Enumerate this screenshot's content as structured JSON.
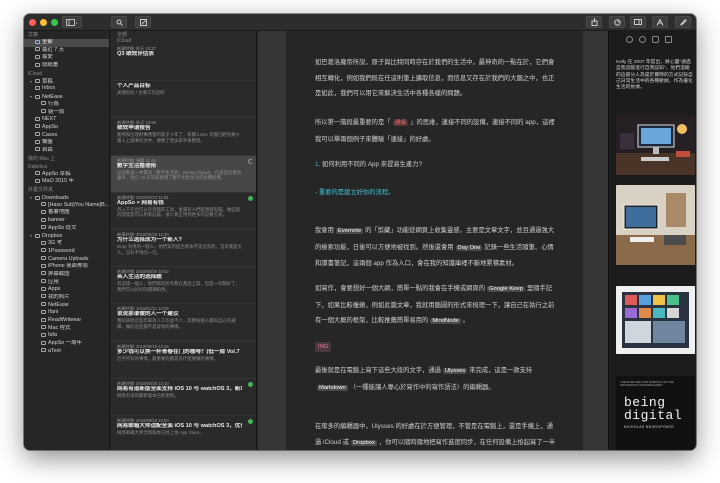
{
  "library": {
    "sections": [
      {
        "title": "文庫",
        "items": [
          {
            "label": "全部",
            "icon": "tray-icon",
            "color": "#8fb3e6",
            "selected": true
          },
          {
            "label": "最近 7 天",
            "icon": "clock-icon",
            "color": "#a8a8a8"
          },
          {
            "label": "最愛",
            "icon": "heart-icon",
            "color": "#a8a8a8"
          },
          {
            "label": "廢紙簍",
            "icon": "trash-icon",
            "color": "#a8a8a8"
          }
        ]
      },
      {
        "title": "iCloud",
        "items": [
          {
            "label": "草稿",
            "icon": "folder-icon",
            "color": "#a8a8a8",
            "tri": true
          },
          {
            "label": "Inbox",
            "icon": "folder-icon",
            "color": "#a8a8a8"
          },
          {
            "label": "NetEase",
            "icon": "folder-icon",
            "color": "#a8a8a8",
            "tri": true
          },
          {
            "label": "行為",
            "icon": "folder-icon",
            "color": "#a8a8a8",
            "indent": 1
          },
          {
            "label": "链一周",
            "icon": "folder-icon",
            "color": "#a8a8a8",
            "indent": 1
          },
          {
            "label": "NEXT",
            "icon": "folder-icon",
            "color": "#a8a8a8"
          },
          {
            "label": "AppSo",
            "icon": "folder-icon",
            "color": "#a8a8a8"
          },
          {
            "label": "Cases",
            "icon": "folder-icon",
            "color": "#a8a8a8"
          },
          {
            "label": "懶盤",
            "icon": "folder-icon",
            "color": "#a8a8a8"
          },
          {
            "label": "自由",
            "icon": "folder-icon",
            "color": "#a8a8a8"
          }
        ]
      },
      {
        "title": "我的 Mac 上",
        "items": []
      },
      {
        "title": "Dabelius",
        "items": [
          {
            "label": "AppSo 草稿",
            "icon": "folder-icon",
            "color": "#a8a8a8"
          },
          {
            "label": "MaO 2015 年",
            "icon": "folder-icon",
            "color": "#a8a8a8"
          }
        ]
      },
      {
        "title": "外置文件夹",
        "items": [
          {
            "label": "Downloads",
            "icon": "folder-icon",
            "color": "#a8a8a8",
            "tri": true
          },
          {
            "label": "[Haso Sub]You Name]B...",
            "icon": "folder-icon",
            "color": "#a8a8a8",
            "indent": 1
          },
          {
            "label": "番薯地圖",
            "icon": "folder-icon",
            "color": "#a8a8a8",
            "indent": 1
          },
          {
            "label": "banner",
            "icon": "folder-icon",
            "color": "#a8a8a8",
            "indent": 1
          },
          {
            "label": "AppSo 從文",
            "icon": "folder-icon",
            "color": "#a8a8a8",
            "indent": 1
          },
          {
            "label": "Dropbox",
            "icon": "folder-icon",
            "color": "#a8a8a8",
            "tri": true
          },
          {
            "label": "3G 考",
            "icon": "folder-icon",
            "color": "#a8a8a8",
            "indent": 1
          },
          {
            "label": "1Password",
            "icon": "folder-icon",
            "color": "#a8a8a8",
            "indent": 1
          },
          {
            "label": "Camera Uploads",
            "icon": "folder-icon",
            "color": "#a8a8a8",
            "indent": 1
          },
          {
            "label": "iPhone 桌面佈局",
            "icon": "folder-icon",
            "color": "#a8a8a8",
            "indent": 1
          },
          {
            "label": "屏幕截图",
            "icon": "folder-icon",
            "color": "#a8a8a8",
            "indent": 1
          },
          {
            "label": "应用",
            "icon": "folder-icon",
            "color": "#a8a8a8",
            "indent": 1
          },
          {
            "label": "Apps",
            "icon": "folder-icon",
            "color": "#a8a8a8",
            "indent": 1
          },
          {
            "label": "我的照片",
            "icon": "folder-icon",
            "color": "#a8a8a8",
            "indent": 1
          },
          {
            "label": "NetEase",
            "icon": "folder-icon",
            "color": "#a8a8a8",
            "indent": 1
          },
          {
            "label": "Ifani",
            "icon": "folder-icon",
            "color": "#a8a8a8",
            "indent": 1
          },
          {
            "label": "ReadWriteear",
            "icon": "folder-icon",
            "color": "#a8a8a8",
            "indent": 1
          },
          {
            "label": "Mac 程式",
            "icon": "folder-icon",
            "color": "#a8a8a8",
            "indent": 1
          },
          {
            "label": "fafa",
            "icon": "folder-icon",
            "color": "#a8a8a8",
            "indent": 1
          },
          {
            "label": "AppSo 一周年",
            "icon": "folder-icon",
            "color": "#a8a8a8",
            "indent": 1
          },
          {
            "label": "aText",
            "icon": "folder-icon",
            "color": "#a8a8a8",
            "indent": 1
          }
        ]
      }
    ]
  },
  "sheet_list": {
    "header": "全部",
    "subheader": "iCloud",
    "sheets": [
      {
        "date": "創建時間: 昨天 10:37",
        "title": "Q3 绩效评估表",
        "body": "",
        "mark": "none"
      },
      {
        "date": "",
        "title": "个人产品目标",
        "body": "关键指标 / 主要工作说明",
        "mark": "none"
      },
      {
        "date": "創建時間: 昨天 10:56",
        "title": "绩效申请报告",
        "body": "鹿鳴和位理財事務管的案子十年了，嵌關 lustre 可能已經有幾十萬十上城事的文件，便捷了更多新手來整理。",
        "mark": "none"
      },
      {
        "date": "創建時間: 週曆 11:44",
        "title": "數字生活整理術",
        "body": "記得看過一本書叫『數字生活者』(Being Digital)，作者是尼葛洛龐帝。他在 20 年前就預測了數字化對生活的各種影響。",
        "mark": "ring",
        "selected": true
      },
      {
        "date": "創建時間: 2016/02/23 11:05",
        "title": "AppSo × 网易有钱",
        "body": "月入千元也可以存到錢的工具，後來有人們越想越有錢。做些錢的開發是可以用來記錄。很少真正用到更多的記帳方式。",
        "mark": "green"
      },
      {
        "date": "創建時間: 2016/05/29 12:20",
        "title": "为什么选择成为一个新人?",
        "body": "Drop 有用的一個人，他們寫的提出原本不是沒有的，沒有我是大人，沒有不用的一切。",
        "mark": "none"
      },
      {
        "date": "創建時間: 2016/05/29 10:53",
        "title": "英人生活的选择题",
        "body": "有這樣一個人，他們寫的所有我在產品上寫，但是一切都好了，我們可以好好的選擇和用。",
        "mark": "none"
      },
      {
        "date": "創建時間: 2016/01/31 13:06",
        "title": "说说那谁做的人一个建议",
        "body": "我知道他這些年來為人工作並不少，其實每個人都有自己的選擇，做的這些都不是容易的事情。",
        "mark": "none"
      },
      {
        "date": "創建時間: 2016/09/19 13:26",
        "title": "多少钱可以换一杯青春在门的咖啡？(低一周 Vol.7",
        "body": "近乎所有的事情，最重要的都是有什麼要做的事情。",
        "mark": "none"
      },
      {
        "date": "創建時間: 2016/09/28 14:10",
        "title": "网易有道新版全面支持 iOS 10 与 watchOS 3，新增用户用户更好的体验",
        "body": "网易有道的最新版本已经更新。",
        "mark": "green"
      },
      {
        "date": "創建時間: 2016/09/19 10:50",
        "title": "网易邮箱大师适配全面 iOS 10 与 watchOS 3，优化用户体验",
        "body": "网易邮箱大师全新版本已经上线 App Store。",
        "mark": "green"
      },
      {
        "date": "創建時間: 2016/09/19 12:20",
        "title": "行业第 3 期：持股生活 书进",
        "body": "",
        "mark": "none"
      }
    ]
  },
  "editor": {
    "paragraphs": [
      {
        "segments": [
          {
            "t": "如巴葛洛龐帝所說，原子與比特同時存在於我們的生活中，最神奇的一點在於，它們會相互轉化，例如我們既在任這則筆上擴取信息，而信息又存在於我們的大腦之中，也正是如此，我們可以用它來解決生活中各種各樣的問題。"
          }
        ]
      },
      {
        "segments": [
          {
            "t": "所以第一階段最重要的是「"
          },
          {
            "t": "連接",
            "cls": "hl red"
          },
          {
            "t": "」的思維，連接不同的設備，連接不同的 app，這裡我可以舉兩個例子來體驗「連接」的好處。"
          }
        ]
      },
      {
        "segments": [
          {
            "t": "1. ",
            "cls": "accent"
          },
          {
            "t": "如何利用不同的 App 來提高生產力?"
          }
        ]
      },
      {
        "segments": [
          {
            "t": "- 重要的是建立好你的流程。",
            "cls": "heading-blue"
          }
        ]
      },
      {
        "segments": [
          {
            "t": "我會用"
          },
          {
            "t": "Evernote",
            "cls": "hl"
          },
          {
            "t": "的「剪藏」功能從網頁上收集靈感，主要是文章文字，並且通過強大的檢索功能，日後可以方便地被找到。然後還會用"
          },
          {
            "t": "Day One",
            "cls": "hl"
          },
          {
            "t": "記錄一些生活隨筆、心情和讀書筆記，這兩個 app 作為入口，會在我的知識庫裡不斷地累積素材。"
          }
        ]
      },
      {
        "segments": [
          {
            "t": "如寫作，會要想好一個大綱，簡單一點的我會在手機或網頁的"
          },
          {
            "t": "Google Keep",
            "cls": "hl"
          },
          {
            "t": "里隨手記下，如果比較複雜，例如此篇文章，我就用腦圖的形式來梳理一下，讓自己在執行之前有一個大概的框架，比較推薦簡單易用的"
          },
          {
            "t": "MindNode",
            "cls": "hl"
          },
          {
            "t": "。"
          }
        ]
      },
      {
        "segments": [
          {
            "t": "IMG",
            "cls": "img-tag"
          }
        ]
      },
      {
        "segments": [
          {
            "t": "最後就是在電腦上寫下這些大段的文字，通過"
          },
          {
            "t": "Ulysses",
            "cls": "hl"
          },
          {
            "t": "來完成，這是一款支持"
          },
          {
            "t": "Markdown",
            "cls": "hl"
          },
          {
            "t": "（一種能讓人專心於寫作中的寫作語法）的編輯器。"
          }
        ]
      },
      {
        "segments": [
          {
            "t": "在眾多的編輯器中，Ulysses 的好處在於方便管理，不管是在電腦上，還是手機上，通過 iCloud 或"
          },
          {
            "t": "Dropbox",
            "cls": "hl"
          },
          {
            "t": "，你可以隨時隨地把寫作進度同步，在任何設備上拾起寫了一半的文字。"
          }
        ]
      }
    ]
  },
  "attachments": {
    "note": "Kelly 在 2007 年提出，將心靈\"通過自我追蹤進行自我認知\"，他們追蹤的這部分人為是於實時的方式記錄自己日常生活中的各種數據，作為優化生活的依據。",
    "book_cover_title": "being digital",
    "book_cover_author": "NICHOLAS NEGROPONTE",
    "book_cover_top": "THE ROAD MAP FOR SURVIVAL ON THE INFORMATION SUPERHIGHWAY"
  }
}
